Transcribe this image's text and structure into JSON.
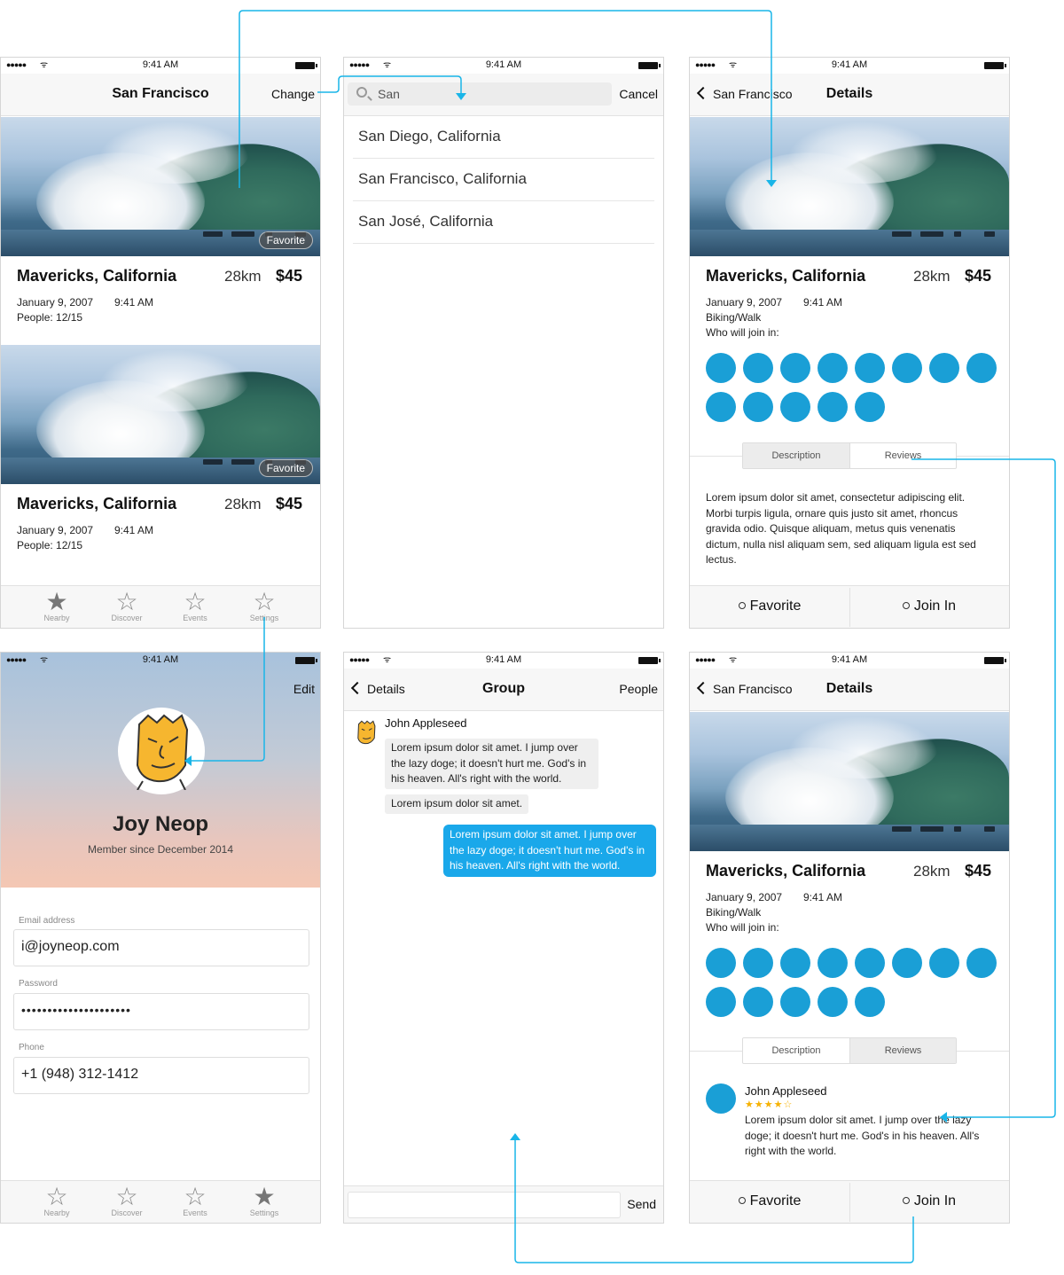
{
  "status": {
    "time": "9:41 AM"
  },
  "colors": {
    "accent": "#1a9fd6",
    "flow": "#19b5e8",
    "bubble_me": "#1aa8ea",
    "star": "#f6b100"
  },
  "list_screen": {
    "title": "San Francisco",
    "change_label": "Change",
    "cards": [
      {
        "title": "Mavericks, California",
        "distance": "28km",
        "price": "$45",
        "date": "January 9, 2007",
        "time": "9:41 AM",
        "people": "People: 12/15",
        "badge": "Favorite"
      },
      {
        "title": "Mavericks, California",
        "distance": "28km",
        "price": "$45",
        "date": "January 9, 2007",
        "time": "9:41 AM",
        "people": "People: 12/15",
        "badge": "Favorite"
      }
    ],
    "tabs": [
      "Nearby",
      "Discover",
      "Events",
      "Settings"
    ]
  },
  "search_screen": {
    "query": "San",
    "cancel_label": "Cancel",
    "results": [
      "San Diego, California",
      "San Francisco, California",
      "San José, California"
    ]
  },
  "details_screen": {
    "back_label": "San Francisco",
    "title": "Details",
    "card_title": "Mavericks, California",
    "distance": "28km",
    "price": "$45",
    "date": "January 9, 2007",
    "time": "9:41 AM",
    "activity": "Biking/Walk",
    "join_label": "Who will join in:",
    "participants": 13,
    "segments": [
      "Description",
      "Reviews"
    ],
    "description": "Lorem ipsum dolor sit amet, consectetur adipiscing elit. Morbi turpis ligula, ornare quis justo sit amet, rhoncus gravida odio. Quisque aliquam, metus quis venenatis dictum, nulla nisl aliquam sem, sed aliquam ligula est sed lectus.",
    "favorite_label": "Favorite",
    "join_in_label": "Join In"
  },
  "profile_screen": {
    "edit_label": "Edit",
    "name": "Joy Neop",
    "since": "Member since December 2014",
    "email_label": "Email address",
    "email": "i@joyneop.com",
    "password_label": "Password",
    "password": "•••••••••••••••••••••",
    "phone_label": "Phone",
    "phone": "+1 (948) 312-1412",
    "tabs": [
      "Nearby",
      "Discover",
      "Events",
      "Settings"
    ]
  },
  "group_screen": {
    "back_label": "Details",
    "title": "Group",
    "people_label": "People",
    "sender": "John Appleseed",
    "msg1": "Lorem ipsum dolor sit amet. I jump over the lazy doge; it doesn't hurt me. God's in his heaven. All's right with the world.",
    "msg2": "Lorem ipsum dolor sit amet.",
    "msg_me": "Lorem ipsum dolor sit amet. I jump over the lazy doge; it doesn't hurt me. God's in his heaven. All's right with the world.",
    "send_label": "Send"
  },
  "reviews_screen": {
    "back_label": "San Francisco",
    "title": "Details",
    "card_title": "Mavericks, California",
    "distance": "28km",
    "price": "$45",
    "date": "January 9, 2007",
    "time": "9:41 AM",
    "activity": "Biking/Walk",
    "join_label": "Who will join in:",
    "segments": [
      "Description",
      "Reviews"
    ],
    "reviewer": "John Appleseed",
    "rating_stars": "★★★★☆",
    "rating": 4,
    "review": "Lorem ipsum dolor sit amet. I jump over the lazy doge; it doesn't hurt me. God's in his heaven. All's right with the world.",
    "favorite_label": "Favorite",
    "join_in_label": "Join In"
  }
}
